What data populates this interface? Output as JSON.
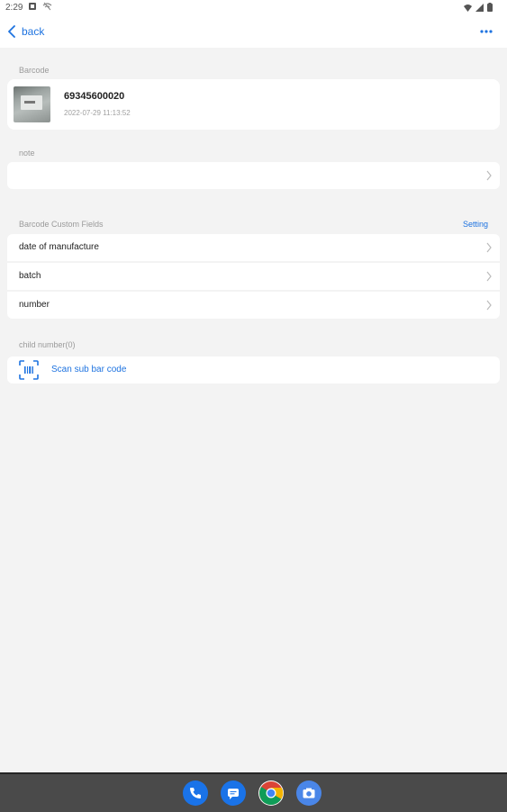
{
  "status_bar": {
    "time": "2:29"
  },
  "header": {
    "back_label": "back"
  },
  "barcode_section": {
    "label": "Barcode",
    "code": "69345600020",
    "timestamp": "2022-07-29 11:13:52"
  },
  "note_section": {
    "label": "note",
    "value": ""
  },
  "custom_fields": {
    "label": "Barcode Custom Fields",
    "setting_label": "Setting",
    "fields": [
      {
        "label": "date of manufacture"
      },
      {
        "label": "batch"
      },
      {
        "label": "number"
      }
    ]
  },
  "child_section": {
    "label": "child number(0)",
    "scan_label": "Scan sub bar code"
  },
  "colors": {
    "accent": "#1e73e0",
    "background": "#f3f3f3",
    "nav_bar": "#4a4a4a"
  },
  "dock": [
    "phone-app",
    "messages-app",
    "chrome-app",
    "camera-app"
  ]
}
